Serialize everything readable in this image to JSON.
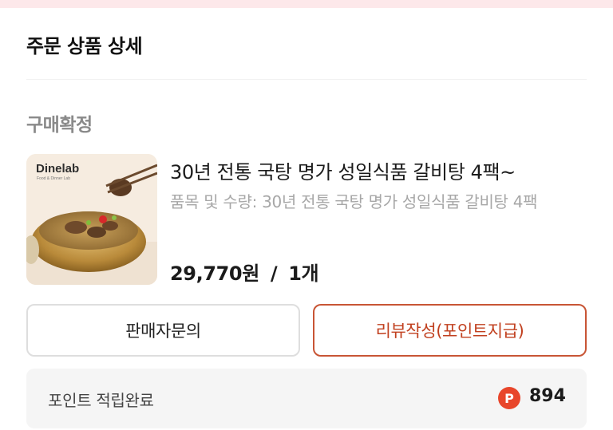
{
  "section": {
    "title": "주문 상품 상세"
  },
  "order": {
    "status": "구매확정",
    "product": {
      "image_brand": "Dinelab",
      "image_tagline": "Food & Dinner Lab",
      "name": "30년 전통 국탕 명가 성일식품 갈비탕 4팩~",
      "option": "품목 및 수량: 30년 전통 국탕 명가 성일식품 갈비탕 4팩",
      "price": "29,770원",
      "separator": "/",
      "quantity": "1개"
    }
  },
  "actions": {
    "seller_inquiry_label": "판매자문의",
    "write_review_label": "리뷰작성(포인트지급)"
  },
  "points": {
    "label": "포인트 적립완료",
    "icon_letter": "P",
    "value": "894",
    "icon_color": "#e8462b"
  },
  "colors": {
    "accent": "#c85535",
    "top_strip": "#fde8ea"
  }
}
